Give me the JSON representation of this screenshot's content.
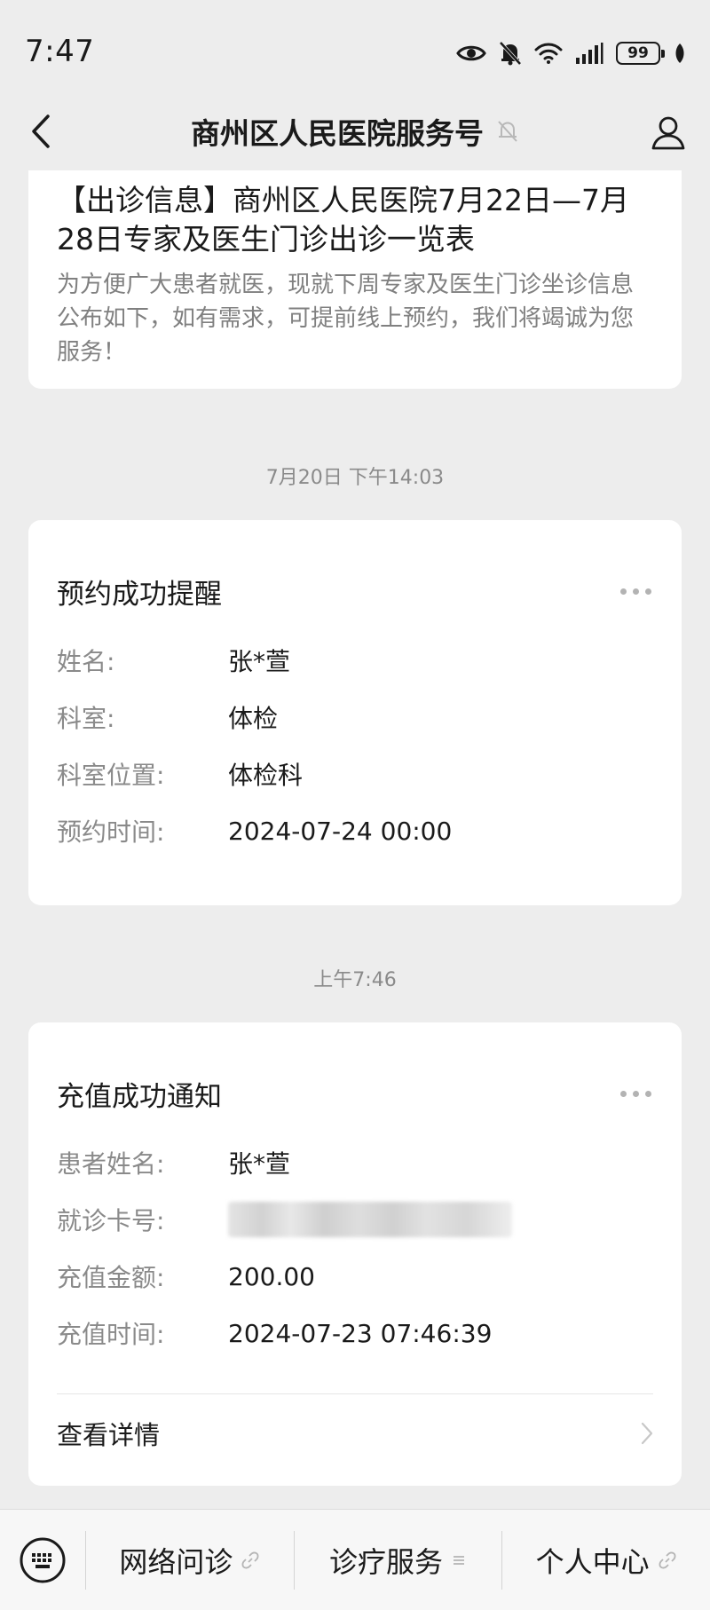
{
  "status_bar": {
    "time": "7:47",
    "battery": "99",
    "icons": [
      "eye-icon",
      "bell-off-icon",
      "wifi-icon",
      "signal-icon",
      "battery-icon",
      "leaf-icon"
    ]
  },
  "header": {
    "title": "商州区人民医院服务号",
    "icons": [
      "back-arrow-icon",
      "mute-bell-icon",
      "profile-icon"
    ]
  },
  "article": {
    "title": "【出诊信息】商州区人民医院7月22日—7月28日专家及医生门诊出诊一览表",
    "summary": "为方便广大患者就医，现就下周专家及医生门诊坐诊信息公布如下，如有需求，可提前线上预约，我们将竭诚为您服务！"
  },
  "messages": [
    {
      "timestamp": "7月20日 下午14:03",
      "title": "预约成功提醒",
      "fields": [
        {
          "label": "姓名:",
          "value": "张*萱"
        },
        {
          "label": "科室:",
          "value": "体检"
        },
        {
          "label": "科室位置:",
          "value": "体检科"
        },
        {
          "label": "预约时间:",
          "value": "2024-07-24 00:00"
        }
      ]
    },
    {
      "timestamp": "上午7:46",
      "title": "充值成功通知",
      "fields": [
        {
          "label": "患者姓名:",
          "value": "张*萱"
        },
        {
          "label": "就诊卡号:",
          "value": ""
        },
        {
          "label": "充值金额:",
          "value": "200.00"
        },
        {
          "label": "充值时间:",
          "value": "2024-07-23 07:46:39"
        }
      ],
      "detail_link": "查看详情"
    }
  ],
  "bottom_menu": {
    "items": [
      {
        "label": "网络问诊",
        "icon": "link-icon"
      },
      {
        "label": "诊疗服务",
        "icon": "submenu-icon"
      },
      {
        "label": "个人中心",
        "icon": "link-icon"
      }
    ]
  }
}
